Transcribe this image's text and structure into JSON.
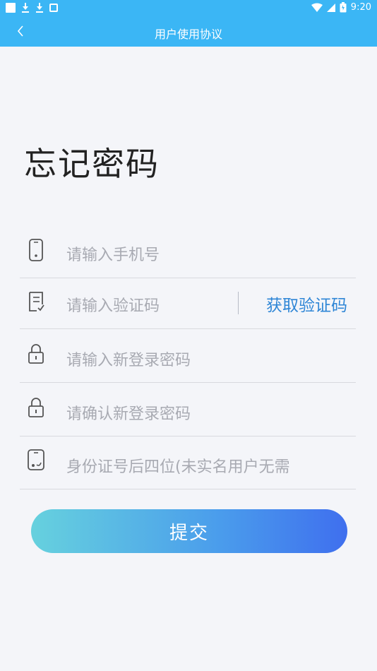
{
  "status_bar": {
    "time": "9:20"
  },
  "navbar": {
    "title": "用户使用协议"
  },
  "page": {
    "title": "忘记密码"
  },
  "form": {
    "phone_placeholder": "请输入手机号",
    "code_placeholder": "请输入验证码",
    "get_code_label": "获取验证码",
    "new_password_placeholder": "请输入新登录密码",
    "confirm_password_placeholder": "请确认新登录密码",
    "id_placeholder": "身份证号后四位(未实名用户无需"
  },
  "submit": {
    "label": "提交"
  },
  "colors": {
    "accent": "#3bb6f5",
    "link": "#2f86d6",
    "background": "#f4f5f9"
  }
}
